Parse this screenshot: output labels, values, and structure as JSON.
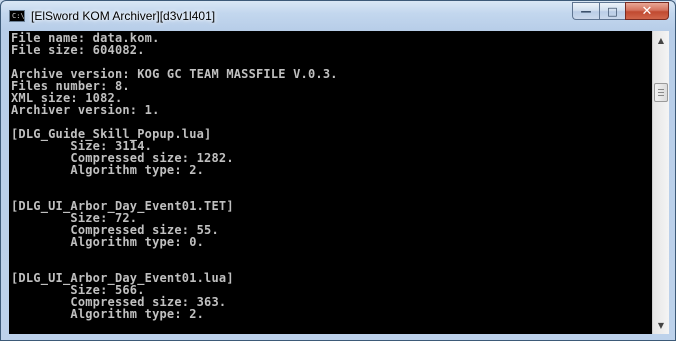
{
  "window": {
    "title": "[ElSword KOM Archiver][d3v1l401]",
    "app_icon_text": "C:\\",
    "minimize_glyph": "—",
    "maximize_glyph": "□",
    "close_glyph": "✕"
  },
  "console": {
    "lines": [
      "File name: data.kom.",
      "File size: 604082.",
      "",
      "Archive version: KOG GC TEAM MASSFILE V.0.3.",
      "Files number: 8.",
      "XML size: 1082.",
      "Archiver version: 1.",
      "",
      "[DLG_Guide_Skill_Popup.lua]",
      "        Size: 3114.",
      "        Compressed size: 1282.",
      "        Algorithm type: 2.",
      "",
      "",
      "[DLG_UI_Arbor_Day_Event01.TET]",
      "        Size: 72.",
      "        Compressed size: 55.",
      "        Algorithm type: 0.",
      "",
      "",
      "[DLG_UI_Arbor_Day_Event01.lua]",
      "        Size: 566.",
      "        Compressed size: 363.",
      "        Algorithm type: 2."
    ]
  },
  "scrollbar": {
    "up_glyph": "▲",
    "down_glyph": "▼",
    "position_fraction": 0.14
  },
  "colors": {
    "console_background": "#000000",
    "console_text": "#c0c0c0",
    "close_button": "#c7503a"
  }
}
